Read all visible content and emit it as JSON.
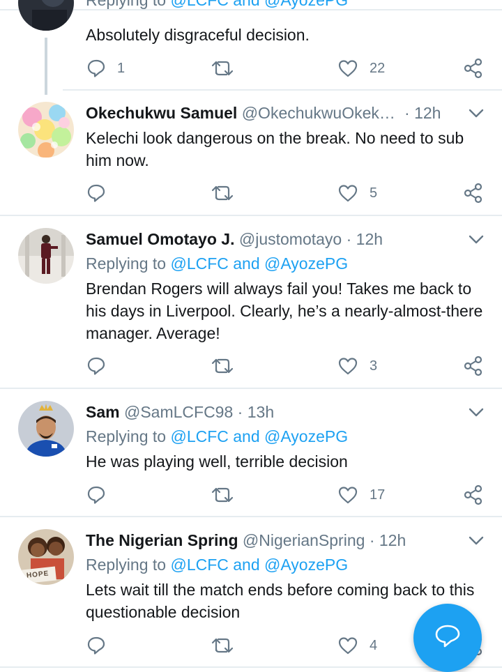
{
  "colors": {
    "accent": "#1da1f2",
    "secondary_text": "#657786",
    "primary_text": "#14171a"
  },
  "tweets": [
    {
      "partial": true,
      "replying_to_label": "Replying to",
      "replying_to_handles": "@LCFC and @AyozePG",
      "text": "Absolutely disgraceful decision.",
      "reply_count": "1",
      "retweet_count": "",
      "like_count": "22"
    },
    {
      "name": "Okechukwu Samuel",
      "handle": "@OkechukwuOkek…",
      "separator": "·",
      "time": "12h",
      "text": "Kelechi look dangerous on the break. No need to sub him now.",
      "reply_count": "",
      "retweet_count": "",
      "like_count": "5"
    },
    {
      "name": "Samuel Omotayo J.",
      "handle": "@justomotayo",
      "separator": "·",
      "time": "12h",
      "replying_to_label": "Replying to",
      "replying_to_handles": "@LCFC and @AyozePG",
      "text": "Brendan Rogers will always fail you! Takes me back to his days in Liverpool. Clearly, he’s a nearly-almost-there manager. Average!",
      "reply_count": "",
      "retweet_count": "",
      "like_count": "3"
    },
    {
      "name": "Sam",
      "handle": "@SamLCFC98",
      "separator": "·",
      "time": "13h",
      "replying_to_label": "Replying to",
      "replying_to_handles": "@LCFC and @AyozePG",
      "text": "He was playing well, terrible decision",
      "reply_count": "",
      "retweet_count": "",
      "like_count": "17"
    },
    {
      "name": "The Nigerian Spring",
      "handle": "@NigerianSpring",
      "separator": "·",
      "time": "12h",
      "replying_to_label": "Replying to",
      "replying_to_handles": "@LCFC and @AyozePG",
      "text": "Lets wait till the match ends before coming back to this questionable decision",
      "reply_count": "",
      "retweet_count": "",
      "like_count": "4",
      "avatar_sign": "HOPE"
    }
  ],
  "icons": {
    "reply": "reply-icon",
    "retweet": "retweet-icon",
    "like": "heart-icon",
    "share": "share-icon",
    "more": "chevron-down-icon",
    "compose": "compose-reply-icon"
  }
}
